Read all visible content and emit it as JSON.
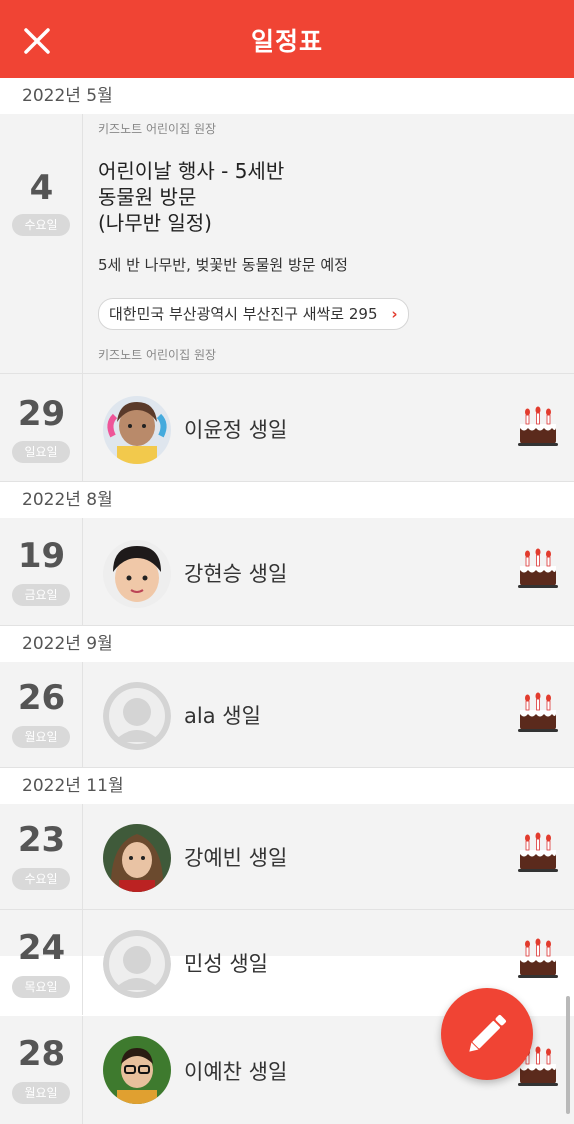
{
  "header": {
    "title": "일정표",
    "close_icon": "close-icon"
  },
  "sections": {
    "may": "2022년 5월",
    "aug": "2022년 8월",
    "sep": "2022년 9월",
    "nov": "2022년 11월"
  },
  "event": {
    "day": "4",
    "weekday": "수요일",
    "author_top": "키즈노트 어린이집 원장",
    "title_line1": "어린이날 행사 - 5세반",
    "title_line2": "동물원 방문",
    "title_line3": "(나무반 일정)",
    "description": "5세 반 나무반, 벚꽃반 동물원 방문 예정",
    "location": "대한민국 부산광역시 부산진구 새싹로 295",
    "author_bottom": "키즈노트 어린이집 원장"
  },
  "birthdays": [
    {
      "day": "29",
      "weekday": "일요일",
      "name": "이윤정 생일",
      "avatar": "child-photo"
    },
    {
      "day": "19",
      "weekday": "금요일",
      "name": "강현승 생일",
      "avatar": "child-photo"
    },
    {
      "day": "26",
      "weekday": "월요일",
      "name": "ala 생일",
      "avatar": "default-avatar"
    },
    {
      "day": "23",
      "weekday": "수요일",
      "name": "강예빈 생일",
      "avatar": "child-photo"
    },
    {
      "day": "24",
      "weekday": "목요일",
      "name": "민성 생일",
      "avatar": "default-avatar"
    },
    {
      "day": "28",
      "weekday": "월요일",
      "name": "이예찬 생일",
      "avatar": "child-photo"
    }
  ],
  "icons": {
    "cake": "birthday-cake-icon",
    "fab": "pencil-icon"
  },
  "colors": {
    "accent": "#f04434",
    "background": "#f3f3f3"
  }
}
